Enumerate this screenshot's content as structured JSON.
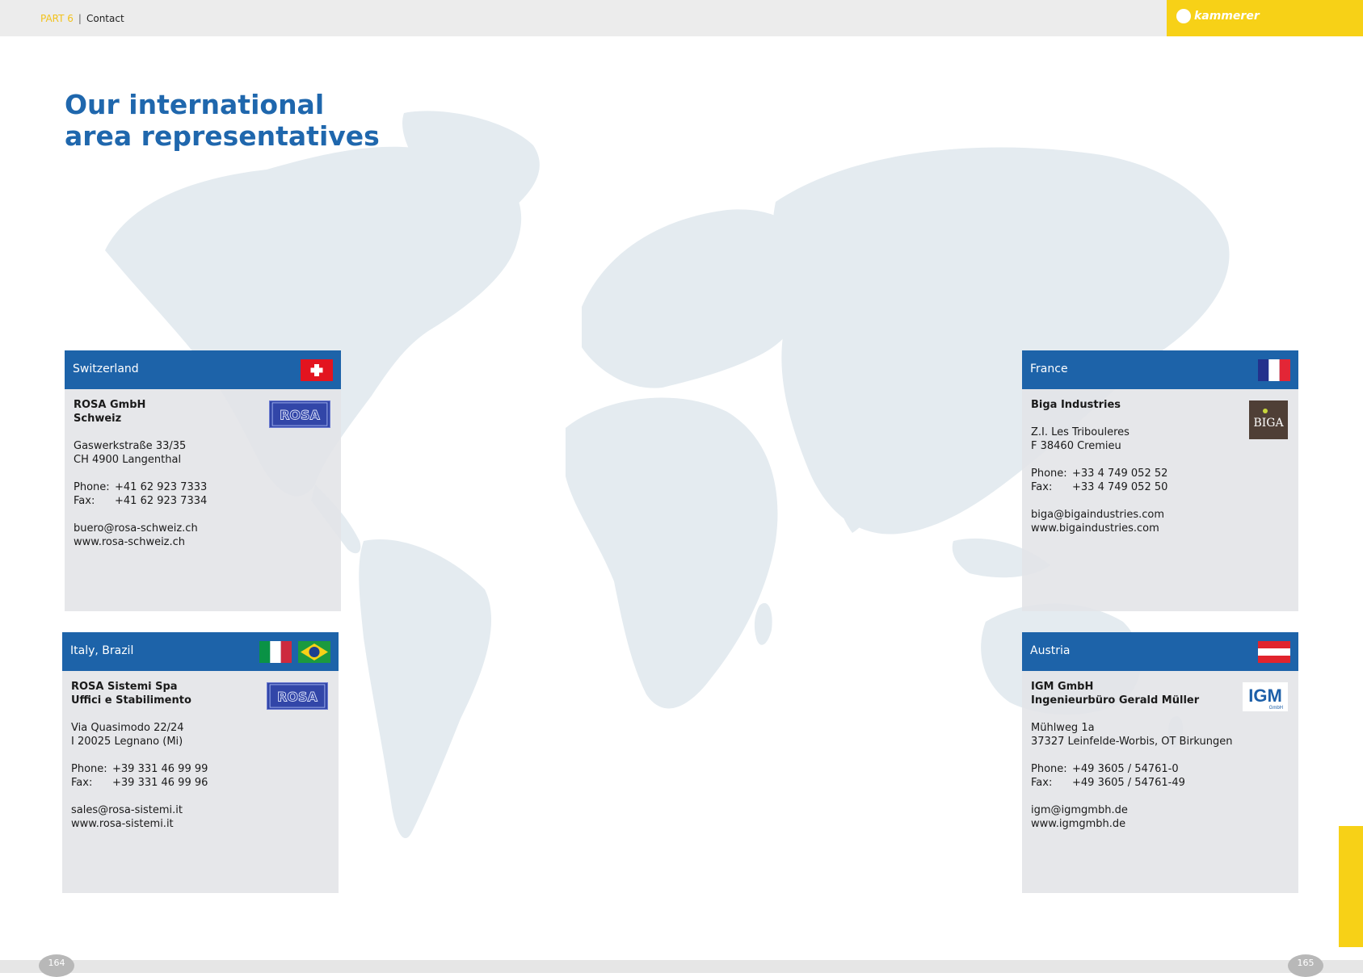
{
  "header": {
    "part": "PART 6",
    "section": "Contact",
    "brand": "kammerer"
  },
  "title": {
    "line1": "Our international",
    "line2": "area representatives"
  },
  "cards": {
    "switzerland": {
      "country": "Switzerland",
      "name1": "ROSA GmbH",
      "name2": "Schweiz",
      "street": "Gaswerkstraße 33/35",
      "city": "CH 4900 Langenthal",
      "phone_label": "Phone:",
      "phone": "+41 62 923 7333",
      "fax_label": "Fax:",
      "fax": "+41 62 923 7334",
      "email": "buero@rosa-schweiz.ch",
      "web": "www.rosa-schweiz.ch",
      "logo_text": "ROSA"
    },
    "italy": {
      "country": "Italy, Brazil",
      "name1": "ROSA Sistemi Spa",
      "name2": "Uffici e Stabilimento",
      "street": "Via Quasimodo 22/24",
      "city": "I 20025 Legnano (Mi)",
      "phone_label": "Phone:",
      "phone": "+39 331 46 99 99",
      "fax_label": "Fax:",
      "fax": "+39 331 46 99 96",
      "email": "sales@rosa-sistemi.it",
      "web": "www.rosa-sistemi.it",
      "logo_text": "ROSA"
    },
    "france": {
      "country": "France",
      "name1": "Biga Industries",
      "street": "Z.I. Les Tribouleres",
      "city": "F 38460 Cremieu",
      "phone_label": "Phone:",
      "phone": "+33 4 749 052 52",
      "fax_label": "Fax:",
      "fax": "+33 4 749 052 50",
      "email": "biga@bigaindustries.com",
      "web": "www.bigaindustries.com",
      "logo_text": "BIGA"
    },
    "austria": {
      "country": "Austria",
      "name1": "IGM GmbH",
      "name2": "Ingenieurbüro Gerald Müller",
      "street": "Mühlweg 1a",
      "city": "37327 Leinfelde-Worbis, OT Birkungen",
      "phone_label": "Phone:",
      "phone": "+49 3605 / 54761-0",
      "fax_label": "Fax:",
      "fax": "+49 3605 / 54761-49",
      "email": "igm@igmgmbh.de",
      "web": "www.igmgmbh.de",
      "logo_text": "IGM",
      "logo_sub": "GmbH"
    }
  },
  "pages": {
    "left": "164",
    "right": "165"
  },
  "colors": {
    "header_blue": "#1d63a9",
    "title_blue": "#1f67ad",
    "accent_yellow": "#f7d117",
    "map": "#e4ebf0"
  }
}
